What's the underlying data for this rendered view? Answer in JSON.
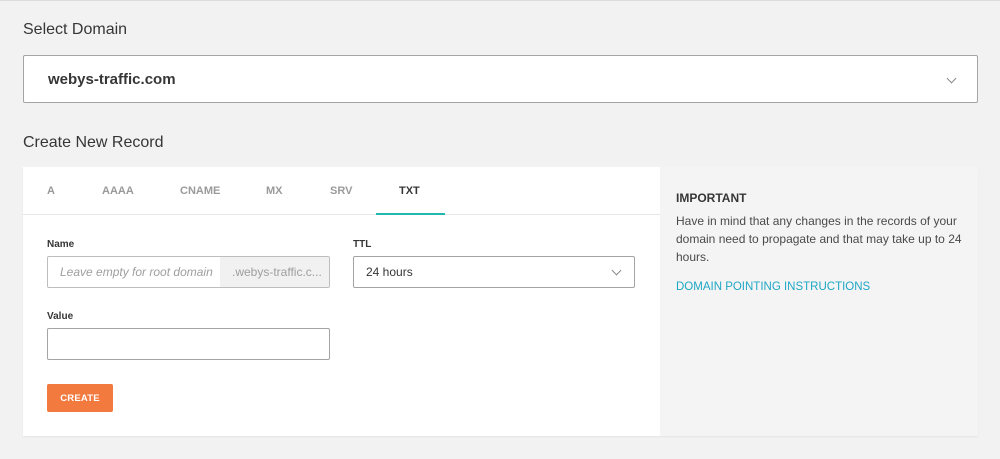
{
  "select_domain": {
    "title": "Select Domain",
    "selected": "webys-traffic.com"
  },
  "create_record": {
    "title": "Create New Record",
    "tabs": [
      {
        "label": "A"
      },
      {
        "label": "AAAA"
      },
      {
        "label": "CNAME"
      },
      {
        "label": "MX"
      },
      {
        "label": "SRV"
      },
      {
        "label": "TXT",
        "active": true
      }
    ],
    "form": {
      "name_label": "Name",
      "name_placeholder": "Leave empty for root domain",
      "name_suffix": ".webys-traffic.c...",
      "ttl_label": "TTL",
      "ttl_value": "24 hours",
      "value_label": "Value",
      "value_value": "",
      "create_label": "CREATE"
    },
    "info": {
      "title": "IMPORTANT",
      "text": "Have in mind that any changes in the records of your domain need to propagate and that may take up to 24 hours.",
      "link": "DOMAIN POINTING INSTRUCTIONS"
    }
  },
  "colors": {
    "accent_tab": "#22b8b0",
    "button": "#f37a3e",
    "link": "#1ea7c5"
  }
}
